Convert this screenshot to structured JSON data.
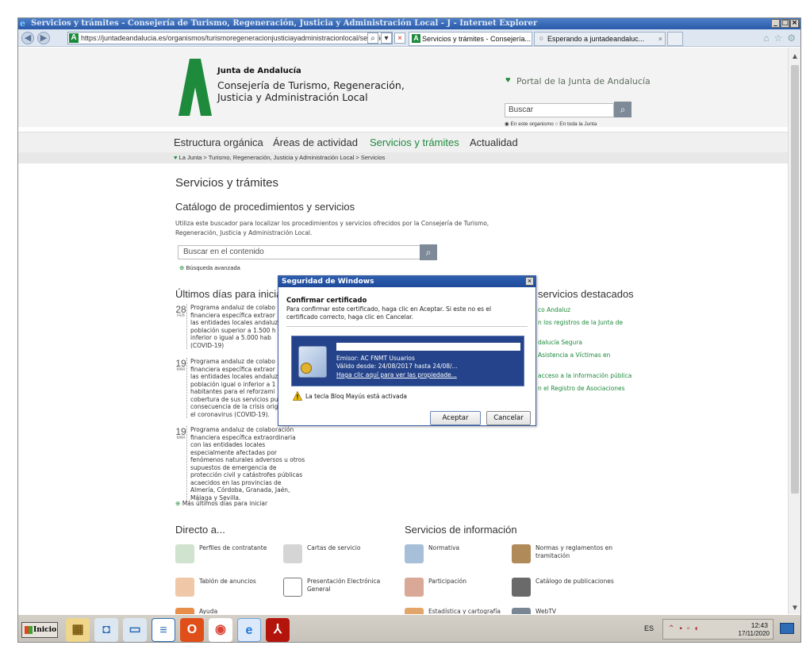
{
  "browser": {
    "window_title": "Servicios y trámites - Consejería de Turismo, Regeneración, Justicia y Administración Local - J - Internet Explorer",
    "address": "https://juntadeandalucia.es/organismos/turismoregeneracionjusticiayadministracionlocal/servicios.",
    "tabs": [
      {
        "label": "Servicios y trámites - Consejería..."
      },
      {
        "label": "Esperando a juntadeandaluc..."
      }
    ]
  },
  "header": {
    "org_name": "Junta de Andalucía",
    "consejeria_line1": "Consejería de Turismo, Regeneración,",
    "consejeria_line2": "Justicia y Administración Local",
    "portal_link": "Portal de la Junta de Andalucía",
    "search_placeholder": "Buscar",
    "radio_this_org": "En este organismo",
    "radio_all_junta": "En toda la Junta"
  },
  "menu": {
    "items": [
      "Estructura orgánica",
      "Áreas de actividad",
      "Servicios y trámites",
      "Actualidad"
    ],
    "active": "Servicios y trámites"
  },
  "breadcrumb": "La Junta > Turismo, Regeneración, Justicia y Administración Local > Servicios",
  "main": {
    "page_title": "Servicios y trámites",
    "catalog_title": "Catálogo de procedimientos y servicios",
    "catalog_desc": "Utiliza este buscador para localizar los procedimientos y servicios ofrecidos por la Consejería de Turismo, Regeneración, Justicia y Administración Local.",
    "content_search_placeholder": "Buscar en el contenido",
    "advanced_search": "Búsqueda avanzada",
    "ultimos_title": "Últimos días para iniciar...",
    "events": [
      {
        "day": "28",
        "month": "FEB",
        "text": "Programa andaluz de colabo financiera específica extraor las entidades locales andaluz población superior a 1.500 h e inferior o igual a 5.000 hab (COVID-19)"
      },
      {
        "day": "19",
        "month": "MAR",
        "text": "Programa andaluz de colabo financiera específica extraor las entidades locales andaluz población igual o inferior a 1 habitantes para el reforzami cobertura de sus servicios pu consecuencia de la crisis orig el coronavirus (COVID-19)."
      },
      {
        "day": "19",
        "month": "MAR",
        "text": "Programa andaluz de colaboración financiera específica extraordinaria con las entidades locales especialmente afectadas por fenómenos naturales adversos u otros supuestos de emergencia de protección civil y catástrofes públicas acaecidos en las provincias de Almería, Córdoba, Granada, Jaén, Málaga y Sevilla."
      }
    ],
    "mas_ultimos": "Más últimos días para iniciar",
    "destacados_title": "servicios destacados",
    "destacados": [
      "co Andaluz",
      "n los registros de la Junta de",
      "dalucía Segura",
      "Asistencia a Víctimas en",
      "acceso a la información pública",
      "n el Registro de Asociaciones"
    ],
    "directo_title": "Directo a...",
    "info_title": "Servicios de información",
    "directo": [
      "Perfiles de contratante",
      "Cartas de servicio",
      "Tablón de anuncios",
      "Presentación Electrónica General",
      "Ayuda"
    ],
    "info": [
      "Normativa",
      "Normas y reglamentos en tramitación",
      "Participación",
      "Catálogo de publicaciones",
      "Estadística y cartografía",
      "WebTV"
    ]
  },
  "dialog": {
    "title": "Seguridad de Windows",
    "heading": "Confirmar certificado",
    "message": "Para confirmar este certificado, haga clic en Aceptar. Si este no es el certificado correcto, haga clic en Cancelar.",
    "issuer": "Emisor: AC FNMT Usuarios",
    "valid": "Válido desde: 24/08/2017 hasta 24/08/...",
    "props_link": "Haga clic aquí para ver las propiedade...",
    "caps_warning": "La tecla Bloq Mayús está activada",
    "ok": "Aceptar",
    "cancel": "Cancelar"
  },
  "taskbar": {
    "start": "Inicio",
    "lang": "ES",
    "time": "12:43",
    "date": "17/11/2020"
  },
  "colors": {
    "brand_green": "#1e8a3c",
    "dialog_blue": "#24438a"
  }
}
